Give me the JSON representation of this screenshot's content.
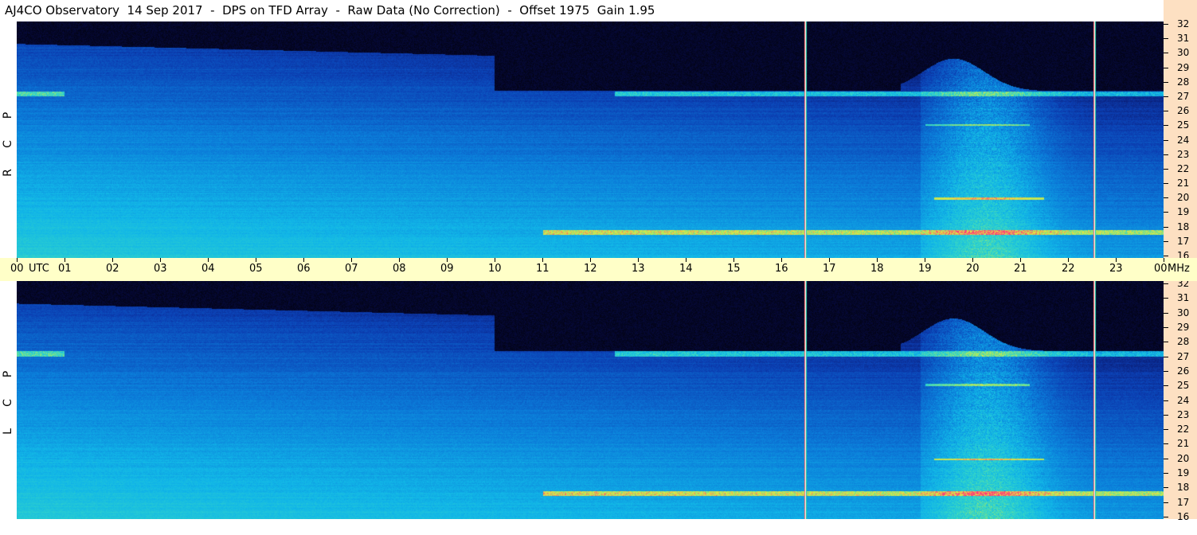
{
  "title": "AJ4CO Observatory  14 Sep 2017  -  DPS on TFD Array  -  Raw Data (No Correction)  -  Offset 1975  Gain 1.95",
  "panels": [
    {
      "id": "rcp",
      "label": [
        "R",
        "C",
        "P"
      ]
    },
    {
      "id": "lcp",
      "label": [
        "L",
        "C",
        "P"
      ]
    }
  ],
  "time_axis": {
    "unit_label": "UTC",
    "freq_unit_label": "MHz",
    "ticks": [
      "00",
      "01",
      "02",
      "03",
      "04",
      "05",
      "06",
      "07",
      "08",
      "09",
      "10",
      "11",
      "12",
      "13",
      "14",
      "15",
      "16",
      "17",
      "18",
      "19",
      "20",
      "21",
      "22",
      "23",
      "00"
    ]
  },
  "colors": {
    "background": "#ffffff",
    "time_bar": "#ffffc8",
    "freq_axis": "#fde0c2",
    "colormap": [
      "#000000",
      "#0a0f5c",
      "#0b3fb3",
      "#0b7cd9",
      "#11b6e8",
      "#33d6c8",
      "#9ee86a",
      "#e6e640",
      "#ff3c7a"
    ]
  },
  "chart_data": {
    "type": "heatmap",
    "title": "AJ4CO Observatory  14 Sep 2017  -  DPS on TFD Array  -  Raw Data (No Correction)  -  Offset 1975  Gain 1.95",
    "x": {
      "label": "UTC",
      "range_hours": [
        0,
        24
      ],
      "ticks": [
        "00",
        "01",
        "02",
        "03",
        "04",
        "05",
        "06",
        "07",
        "08",
        "09",
        "10",
        "11",
        "12",
        "13",
        "14",
        "15",
        "16",
        "17",
        "18",
        "19",
        "20",
        "21",
        "22",
        "23",
        "00"
      ]
    },
    "y": {
      "label": "MHz",
      "range_mhz": [
        16,
        32
      ],
      "ticks": [
        16,
        17,
        18,
        19,
        20,
        21,
        22,
        23,
        24,
        25,
        26,
        27,
        28,
        29,
        30,
        31,
        32
      ]
    },
    "series": [
      {
        "name": "RCP"
      },
      {
        "name": "LCP"
      }
    ],
    "features": {
      "vertical_lines_hour": [
        16.5,
        22.55
      ],
      "interference_bands_mhz": [
        27.1,
        17.7,
        25.0,
        20.0
      ],
      "emission_window_hours": [
        18.9,
        22.5
      ],
      "ionospheric_cutoff_night_mhz": 30.5,
      "ionospheric_cutoff_day_mhz": 27.3
    }
  }
}
